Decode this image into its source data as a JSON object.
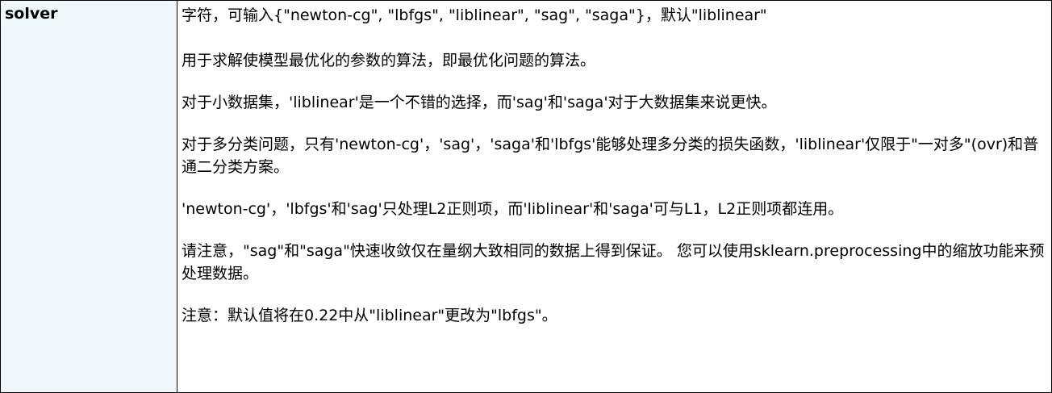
{
  "parameter": {
    "name": "solver"
  },
  "description": {
    "paragraphs": [
      "字符，可输入{\"newton-cg\", \"lbfgs\", \"liblinear\", \"sag\", \"saga\"}，默认\"liblinear\"",
      "用于求解使模型最优化的参数的算法，即最优化问题的算法。",
      "对于小数据集，'liblinear'是一个不错的选择，而'sag'和'saga'对于大数据集来说更快。",
      "对于多分类问题，只有'newton-cg'，'sag'，'saga'和'lbfgs'能够处理多分类的损失函数，'liblinear'仅限于\"一对多\"(ovr)和普通二分类方案。",
      "'newton-cg'，'lbfgs'和'sag'只处理L2正则项，而'liblinear'和'saga'可与L1，L2正则项都连用。",
      "请注意，\"sag\"和\"saga\"快速收敛仅在量纲大致相同的数据上得到保证。 您可以使用sklearn.preprocessing中的缩放功能来预处理数据。",
      "注意：默认值将在0.22中从\"liblinear\"更改为\"lbfgs\"。"
    ]
  }
}
